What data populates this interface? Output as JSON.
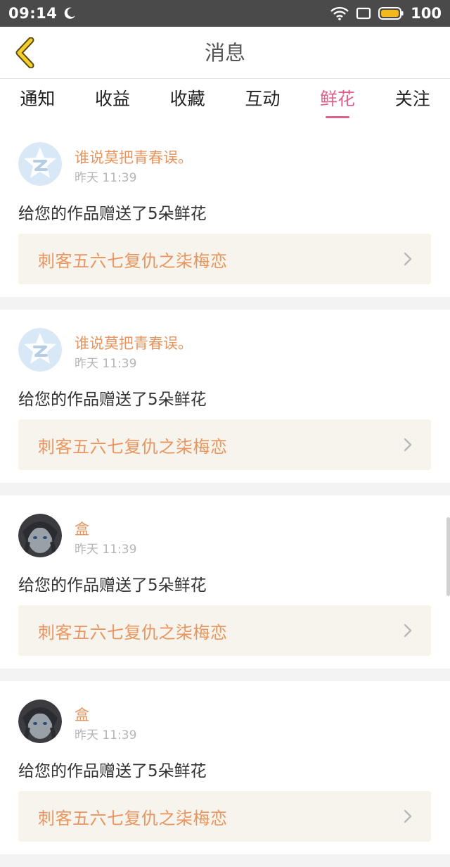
{
  "status_bar": {
    "time": "09:14",
    "battery": "100",
    "icons": [
      "moon-icon",
      "wifi-icon",
      "screen-icon",
      "battery-icon"
    ]
  },
  "header": {
    "title": "消息",
    "back_icon": "chevron-left-icon"
  },
  "tabs": [
    {
      "label": "通知",
      "active": false
    },
    {
      "label": "收益",
      "active": false
    },
    {
      "label": "收藏",
      "active": false
    },
    {
      "label": "互动",
      "active": false
    },
    {
      "label": "鲜花",
      "active": true
    },
    {
      "label": "关注",
      "active": false
    }
  ],
  "messages": [
    {
      "user": "谁说莫把青春误。",
      "time": "昨天 11:39",
      "text": "给您的作品赠送了5朵鲜花",
      "work": "刺客五六七复仇之柒梅恋",
      "avatar": "default-qq-avatar"
    },
    {
      "user": "谁说莫把青春误。",
      "time": "昨天 11:39",
      "text": "给您的作品赠送了5朵鲜花",
      "work": "刺客五六七复仇之柒梅恋",
      "avatar": "default-qq-avatar"
    },
    {
      "user": "盒",
      "time": "昨天 11:39",
      "text": "给您的作品赠送了5朵鲜花",
      "work": "刺客五六七复仇之柒梅恋",
      "avatar": "anime-avatar"
    },
    {
      "user": "盒",
      "time": "昨天 11:39",
      "text": "给您的作品赠送了5朵鲜花",
      "work": "刺客五六七复仇之柒梅恋",
      "avatar": "anime-avatar"
    }
  ],
  "colors": {
    "accent_pink": "#e0608c",
    "name_orange": "#e8955f",
    "link_bg": "#f6f4ec",
    "status_bg": "#4a4a4a"
  }
}
